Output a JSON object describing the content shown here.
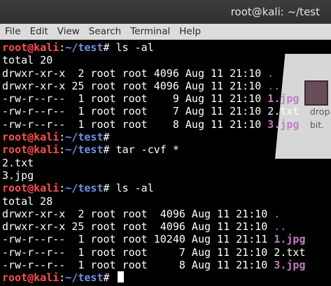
{
  "window": {
    "title": "root@kali: ~/test"
  },
  "menu": [
    "File",
    "Edit",
    "View",
    "Search",
    "Terminal",
    "Help"
  ],
  "desktop": {
    "label_line1": "drop",
    "label_line2": "bit."
  },
  "prompt": {
    "user_host": "root@kali",
    "sep": ":",
    "path": "~/test",
    "symbol": "# "
  },
  "terminal": [
    {
      "type": "prompt",
      "cmd": "ls -al"
    },
    {
      "type": "text",
      "text": "total 20"
    },
    {
      "type": "entry",
      "prefix": "drwxr-xr-x  2 root root 4096 Aug 11 21:10 ",
      "name": ".",
      "kind": "dir"
    },
    {
      "type": "entry",
      "prefix": "drwxr-xr-x 25 root root 4096 Aug 11 21:10 ",
      "name": "..",
      "kind": "dir"
    },
    {
      "type": "entry",
      "prefix": "-rw-r--r--  1 root root    9 Aug 11 21:10 ",
      "name": "1.jpg",
      "kind": "jpg"
    },
    {
      "type": "entry",
      "prefix": "-rw-r--r--  1 root root    7 Aug 11 21:10 ",
      "name": "2.txt",
      "kind": "plain"
    },
    {
      "type": "entry",
      "prefix": "-rw-r--r--  1 root root    8 Aug 11 21:10 ",
      "name": "3.jpg",
      "kind": "jpg"
    },
    {
      "type": "prompt",
      "cmd": ""
    },
    {
      "type": "prompt",
      "cmd": "tar -cvf *"
    },
    {
      "type": "text",
      "text": "2.txt"
    },
    {
      "type": "text",
      "text": "3.jpg"
    },
    {
      "type": "prompt",
      "cmd": "ls -al"
    },
    {
      "type": "text",
      "text": "total 28"
    },
    {
      "type": "entry",
      "prefix": "drwxr-xr-x  2 root root  4096 Aug 11 21:10 ",
      "name": ".",
      "kind": "dir"
    },
    {
      "type": "entry",
      "prefix": "drwxr-xr-x 25 root root  4096 Aug 11 21:10 ",
      "name": "..",
      "kind": "dir"
    },
    {
      "type": "entry",
      "prefix": "-rw-r--r--  1 root root 10240 Aug 11 21:11 ",
      "name": "1.jpg",
      "kind": "jpg"
    },
    {
      "type": "entry",
      "prefix": "-rw-r--r--  1 root root     7 Aug 11 21:10 ",
      "name": "2.txt",
      "kind": "plain"
    },
    {
      "type": "entry",
      "prefix": "-rw-r--r--  1 root root     8 Aug 11 21:10 ",
      "name": "3.jpg",
      "kind": "jpg"
    },
    {
      "type": "prompt",
      "cmd": "",
      "cursor": true
    }
  ]
}
